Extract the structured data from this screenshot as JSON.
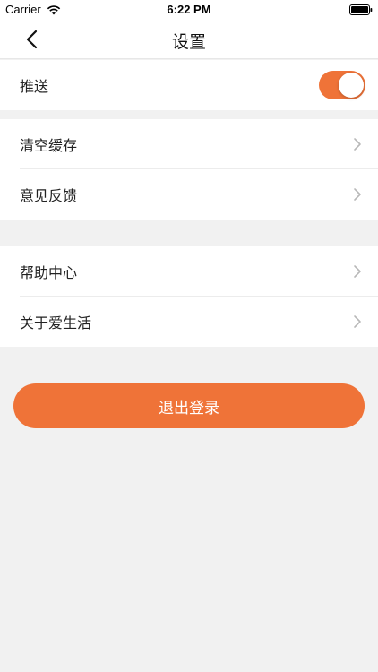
{
  "status_bar": {
    "carrier": "Carrier",
    "time": "6:22 PM",
    "wifi_icon": "wifi-icon",
    "battery_icon": "battery-icon"
  },
  "nav": {
    "title": "设置",
    "back_icon": "chevron-left-icon"
  },
  "sections": [
    {
      "items": [
        {
          "label": "推送",
          "control": "toggle",
          "toggle_on": true
        }
      ]
    },
    {
      "items": [
        {
          "label": "清空缓存",
          "control": "chevron"
        },
        {
          "label": "意见反馈",
          "control": "chevron"
        }
      ]
    },
    {
      "items": [
        {
          "label": "帮助中心",
          "control": "chevron"
        },
        {
          "label": "关于爱生活",
          "control": "chevron"
        }
      ]
    }
  ],
  "logout": {
    "label": "退出登录"
  },
  "colors": {
    "accent": "#ef7338",
    "background": "#f1f1f1",
    "surface": "#ffffff"
  }
}
